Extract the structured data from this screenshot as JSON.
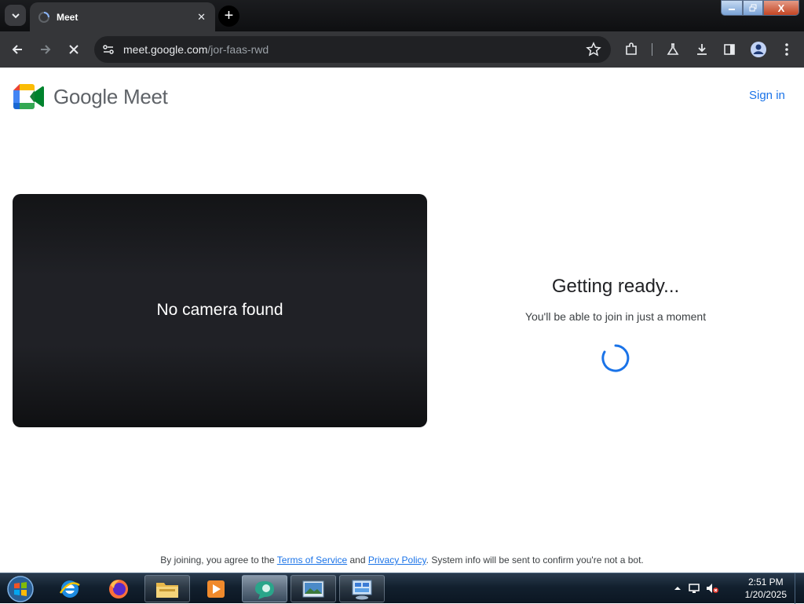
{
  "browser": {
    "tab_title": "Meet",
    "tab_close": "✕",
    "new_tab": "+",
    "url_domain": "meet.google.com",
    "url_path": "/jor-faas-rwd",
    "window_close": "X"
  },
  "page": {
    "brand": "Google Meet",
    "sign_in": "Sign in",
    "camera_status": "No camera found",
    "ready_title": "Getting ready...",
    "ready_subtitle": "You'll be able to join in just a moment",
    "footer": {
      "prefix": "By joining, you agree to the ",
      "terms": "Terms of Service",
      "and": " and ",
      "privacy": "Privacy Policy",
      "suffix": ". System info will be sent to confirm you're not a bot."
    }
  },
  "taskbar": {
    "time": "2:51 PM",
    "date": "1/20/2025"
  },
  "colors": {
    "accent": "#1a73e8",
    "toolbar": "#353639",
    "preview": "#202124"
  }
}
